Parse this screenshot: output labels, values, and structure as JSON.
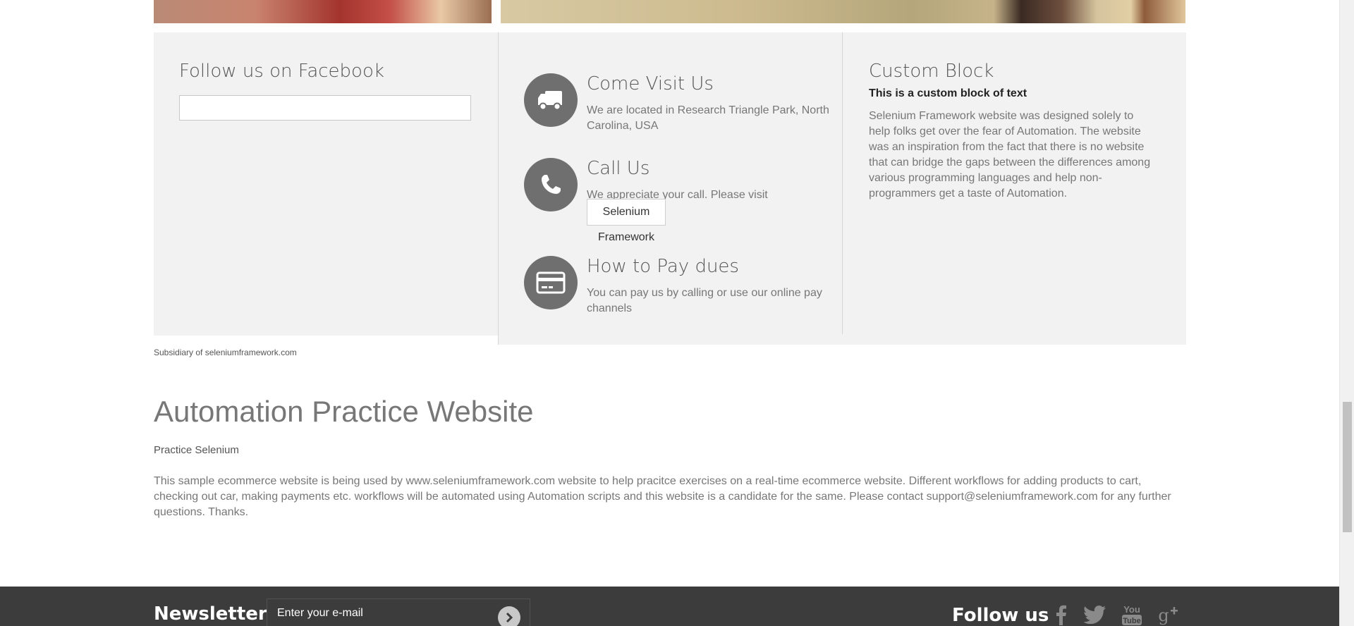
{
  "facebook": {
    "title": "Follow us on Facebook"
  },
  "info": {
    "visit": {
      "icon": "truck-icon",
      "title": "Come Visit Us",
      "text": "We are located in Research Triangle Park, North Carolina, USA"
    },
    "call": {
      "icon": "phone-icon",
      "title": "Call Us",
      "text": "We appreciate your call. Please visit",
      "button_label": "Selenium Framework"
    },
    "pay": {
      "icon": "credit-card-icon",
      "title": "How to Pay dues",
      "text": "You can pay us by calling or use our online pay channels"
    }
  },
  "custom_block": {
    "title": "Custom Block",
    "subtitle": "This is a custom block of text",
    "text": "Selenium Framework website was designed solely to help folks get over the fear of Automation. The website was an inspiration from the fact that there is no website that can bridge the gaps between the differences among various programming languages and help non-programmers get a taste of Automation."
  },
  "subsidiary": "Subsidiary of seleniumframework.com",
  "main": {
    "heading": "Automation Practice Website",
    "tagline": "Practice Selenium",
    "description": "This sample ecommerce website is being used by www.seleniumframework.com website to help pracitce exercises on a real-time ecommerce website. Different workflows for adding products to cart, checking out car, making payments etc. workflows will be automated using Automation scripts and this website is a candidate for the same. Please contact support@seleniumframework.com for any further questions. Thanks."
  },
  "footer": {
    "newsletter_label": "Newsletter",
    "newsletter_placeholder": "Enter your e-mail",
    "follow_label": "Follow us",
    "social_icons": [
      "facebook-icon",
      "twitter-icon",
      "youtube-icon",
      "google-plus-icon"
    ]
  },
  "colors": {
    "panel_bg": "#f2f2f2",
    "icon_circle": "#6f6f6f",
    "footer_bg": "#3c3c3c",
    "text_grey": "#777777"
  }
}
